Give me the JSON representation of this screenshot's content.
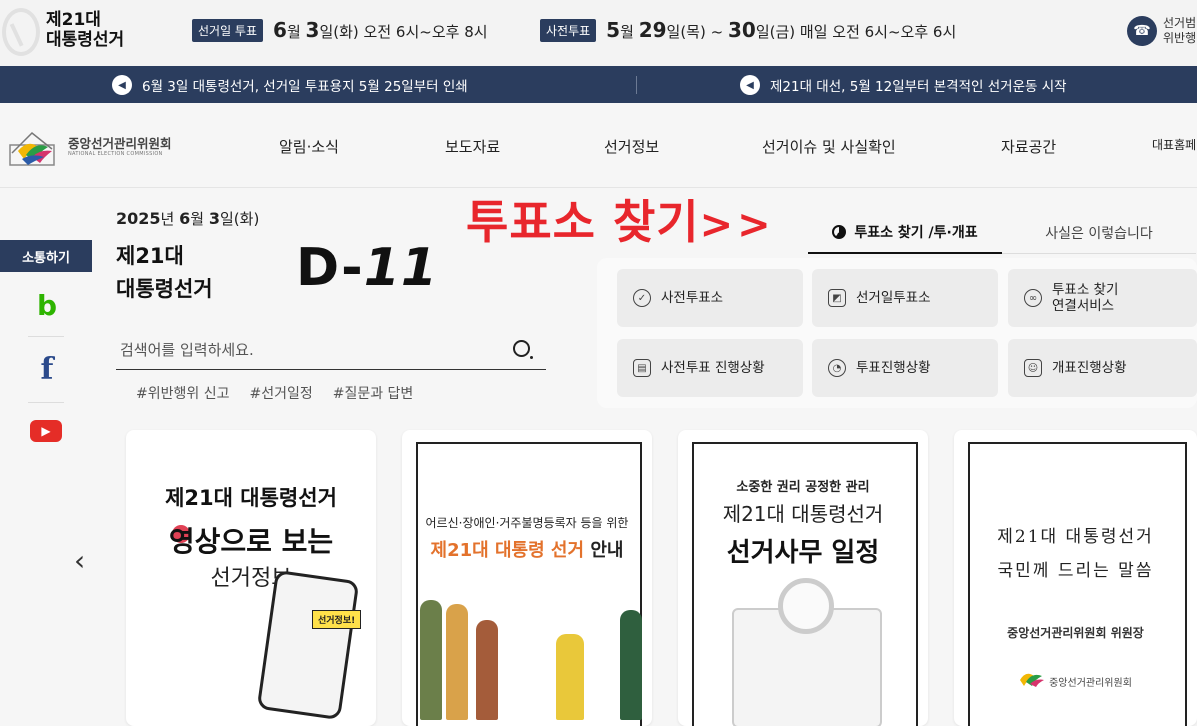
{
  "header": {
    "title_line1": "제21대",
    "title_line2": "대통령선거",
    "election_day_chip": "선거일 투표",
    "election_day": {
      "month": "6",
      "month_unit": "월",
      "day": "3",
      "day_suffix": "일(화)",
      "hours": "오전 6시~오후 8시"
    },
    "early_vote_chip": "사전투표",
    "early_vote": {
      "month": "5",
      "month_unit": "월",
      "day1": "29",
      "day1_suffix": "일(목) ~",
      "day2": "30",
      "day2_suffix": "일(금)",
      "hours": "매일 오전 6시~오후 6시"
    },
    "report_line1": "선거범",
    "report_line2": "위반행"
  },
  "notices": [
    {
      "text": "6월 3일 대통령선거, 선거일 투표용지 5월 25일부터 인쇄"
    },
    {
      "text": "제21대 대선, 5월 12일부터 본격적인 선거운동 시작"
    }
  ],
  "nav": {
    "org_name": "중앙선거관리위원회",
    "org_name_en": "NATIONAL ELECTION COMMISSION",
    "menu": [
      "알림·소식",
      "보도자료",
      "선거정보",
      "선거이슈 및 사실확인",
      "자료공간",
      "대표홈페"
    ]
  },
  "hero": {
    "date_year": "2025",
    "date_year_unit": "년",
    "date_month": "6",
    "date_month_unit": "월",
    "date_day": "3",
    "date_day_suffix": "일(화)",
    "title_line1": "제21대",
    "title_line2": "대통령선거",
    "dday_prefix": "D-",
    "dday_num": "11",
    "search_placeholder": "검색어를 입력하세요.",
    "tags": [
      "#위반행위 신고",
      "#선거일정",
      "#질문과 답변"
    ]
  },
  "sns": {
    "title": "소통하기",
    "items": [
      {
        "label": "b",
        "color": "#2db400"
      },
      {
        "label": "f",
        "color": "#2b4a8b"
      },
      {
        "label": "▶",
        "color": "#e52d27"
      }
    ]
  },
  "annotation": {
    "text": "투표소 찾기",
    "arrows": ">>"
  },
  "panel": {
    "tabs": [
      "투표소 찾기 /투·개표",
      "사실은 이렇습니다"
    ],
    "buttons": [
      {
        "label": "사전투표소",
        "icon": "check-circle-icon"
      },
      {
        "label": "선거일투표소",
        "icon": "image-box-icon"
      },
      {
        "label": "투표소 찾기\n연결서비스",
        "icon": "link-icon"
      },
      {
        "label": "사전투표 진행상황",
        "icon": "chart-box-icon"
      },
      {
        "label": "투표진행상황",
        "icon": "pie-icon"
      },
      {
        "label": "개표진행상황",
        "icon": "person-check-icon"
      }
    ]
  },
  "cards": [
    {
      "line1": "제21대 대통령선거",
      "line2": "영상으로 보는",
      "line3": "선거정보",
      "badge": "선거정보!"
    },
    {
      "line1": "어르신·장애인·거주불명등록자 등을 위한",
      "line2_accent": "제21대 대통령 선거",
      "line2_end": "안내"
    },
    {
      "line0": "소중한 권리 공정한 관리",
      "line1": "제21대 대통령선거",
      "line2": "선거사무 일정"
    },
    {
      "line1": "제21대 대통령선거",
      "line2": "국민께 드리는 말씀",
      "line3": "중앙선거관리위원회 위원장",
      "logo_text": "중앙선거관리위원회"
    }
  ]
}
